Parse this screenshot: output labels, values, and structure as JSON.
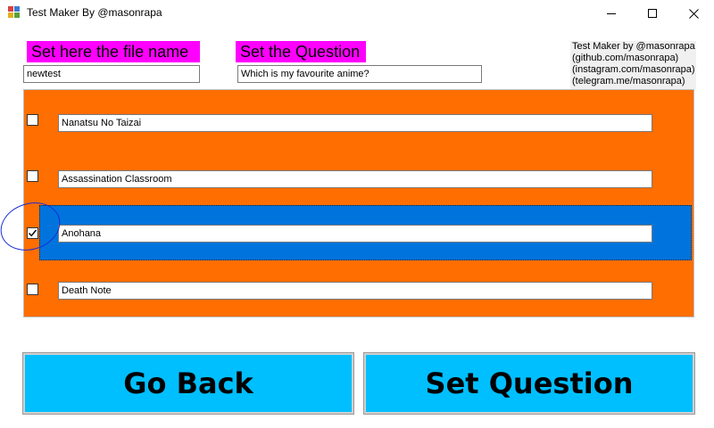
{
  "window": {
    "title": "Test Maker By @masonrapa",
    "minimize": "minimize",
    "maximize": "maximize",
    "close": "close"
  },
  "header": {
    "file_label": "Set here the file name",
    "question_label": "Set the Question",
    "file_value": "newtest",
    "question_value": "Which is my favourite anime?",
    "credits": [
      "Test Maker by @masonrapa",
      "(github.com/masonrapa)",
      "(instagram.com/masonrapa)",
      "(telegram.me/masonrapa)"
    ]
  },
  "answers": [
    {
      "text": "Nanatsu No Taizai",
      "checked": false
    },
    {
      "text": "Assassination Classroom",
      "checked": false
    },
    {
      "text": "Anohana",
      "checked": true
    },
    {
      "text": "Death Note",
      "checked": false
    }
  ],
  "buttons": {
    "back": "Go Back",
    "set": "Set Question"
  },
  "colors": {
    "label_bg": "#ff00ff",
    "panel_bg": "#ff6e00",
    "selected_row": "#0074dc",
    "button_bg": "#00bfff",
    "annotation_circle": "#1a2bd8"
  },
  "icons": {
    "app": "app-icon",
    "minimize": "minimize-icon",
    "maximize": "maximize-icon",
    "close": "close-icon",
    "check": "checkmark-icon"
  }
}
